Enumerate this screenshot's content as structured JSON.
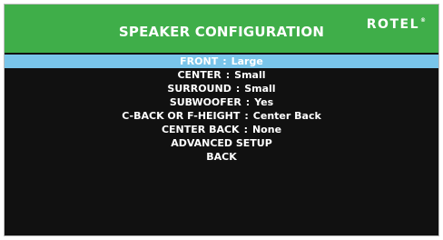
{
  "header": {
    "title": "SPEAKER CONFIGURATION",
    "logo_text": "ROTEL",
    "logo_mark": "®"
  },
  "colors": {
    "header_green": "#3fae49",
    "selection_blue": "#79c5ea",
    "background": "#111111",
    "text": "#ffffff"
  },
  "menu": {
    "selected_index": 0,
    "separator": ":",
    "items": [
      {
        "label": "FRONT",
        "value": "Large"
      },
      {
        "label": "CENTER",
        "value": "Small"
      },
      {
        "label": "SURROUND",
        "value": "Small"
      },
      {
        "label": "SUBWOOFER",
        "value": "Yes"
      },
      {
        "label": "C-BACK OR F-HEIGHT",
        "value": "Center Back"
      },
      {
        "label": "CENTER BACK",
        "value": "None"
      },
      {
        "label": "ADVANCED SETUP"
      },
      {
        "label": "BACK"
      }
    ]
  }
}
